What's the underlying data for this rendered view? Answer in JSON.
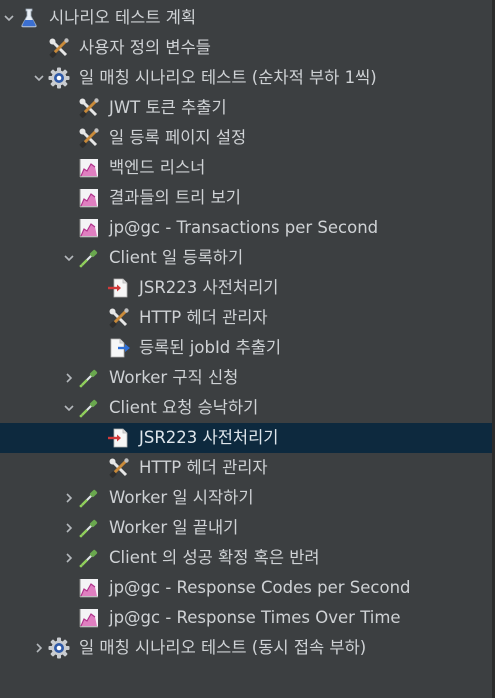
{
  "tree": {
    "items": [
      {
        "label": "시나리오 테스트 계획",
        "icon": "flask-icon",
        "chev": "down",
        "depth": 0,
        "name": "test-plan"
      },
      {
        "label": "사용자 정의 변수들",
        "icon": "wrench-icon",
        "chev": "",
        "depth": 1,
        "name": "user-variables"
      },
      {
        "label": "일 매칭 시나리오 테스트 (순차적 부하 1씩)",
        "icon": "gear-icon",
        "chev": "down",
        "depth": 1,
        "name": "thread-group-sequential"
      },
      {
        "label": "JWT 토큰 추출기",
        "icon": "wrench-icon",
        "chev": "",
        "depth": 2,
        "name": "jwt-token-extractor"
      },
      {
        "label": "일 등록 페이지 설정",
        "icon": "wrench-icon",
        "chev": "",
        "depth": 2,
        "name": "job-register-page-config"
      },
      {
        "label": "백엔드 리스너",
        "icon": "graph-icon",
        "chev": "",
        "depth": 2,
        "name": "backend-listener"
      },
      {
        "label": "결과들의 트리 보기",
        "icon": "graph-icon",
        "chev": "",
        "depth": 2,
        "name": "view-results-tree"
      },
      {
        "label": "jp@gc - Transactions per Second",
        "icon": "graph-icon",
        "chev": "",
        "depth": 2,
        "name": "transactions-per-second"
      },
      {
        "label": "Client 일 등록하기",
        "icon": "pipette-icon",
        "chev": "down",
        "depth": 2,
        "name": "client-job-register"
      },
      {
        "label": "JSR223 사전처리기",
        "icon": "preprocessor-icon",
        "chev": "",
        "depth": 3,
        "name": "jsr223-preprocessor-1"
      },
      {
        "label": "HTTP 헤더 관리자",
        "icon": "wrench-icon",
        "chev": "",
        "depth": 3,
        "name": "http-header-manager-1"
      },
      {
        "label": "등록된 jobId 추출기",
        "icon": "extractor-icon",
        "chev": "",
        "depth": 3,
        "name": "jobid-extractor"
      },
      {
        "label": "Worker 구직 신청",
        "icon": "pipette-icon",
        "chev": "right",
        "depth": 2,
        "name": "worker-job-apply"
      },
      {
        "label": "Client 요청 승낙하기",
        "icon": "pipette-icon",
        "chev": "down",
        "depth": 2,
        "name": "client-accept-request"
      },
      {
        "label": "JSR223 사전처리기",
        "icon": "preprocessor-icon",
        "chev": "",
        "depth": 3,
        "name": "jsr223-preprocessor-2",
        "selected": true
      },
      {
        "label": "HTTP 헤더 관리자",
        "icon": "wrench-icon",
        "chev": "",
        "depth": 3,
        "name": "http-header-manager-2"
      },
      {
        "label": "Worker 일 시작하기",
        "icon": "pipette-icon",
        "chev": "right",
        "depth": 2,
        "name": "worker-job-start"
      },
      {
        "label": "Worker 일 끝내기",
        "icon": "pipette-icon",
        "chev": "right",
        "depth": 2,
        "name": "worker-job-finish"
      },
      {
        "label": "Client 의 성공 확정 혹은 반려",
        "icon": "pipette-icon",
        "chev": "right",
        "depth": 2,
        "name": "client-confirm-or-reject"
      },
      {
        "label": "jp@gc - Response Codes per Second",
        "icon": "graph-icon",
        "chev": "",
        "depth": 2,
        "name": "response-codes-per-second"
      },
      {
        "label": "jp@gc - Response Times Over Time",
        "icon": "graph-icon",
        "chev": "",
        "depth": 2,
        "name": "response-times-over-time"
      },
      {
        "label": "일 매칭 시나리오 테스트 (동시 접속 부하)",
        "icon": "gear-icon",
        "chev": "right",
        "depth": 1,
        "name": "thread-group-concurrent"
      }
    ]
  },
  "colors": {
    "background": "#3c3f41",
    "selection": "#0d293e",
    "text": "#cfd2d5"
  }
}
